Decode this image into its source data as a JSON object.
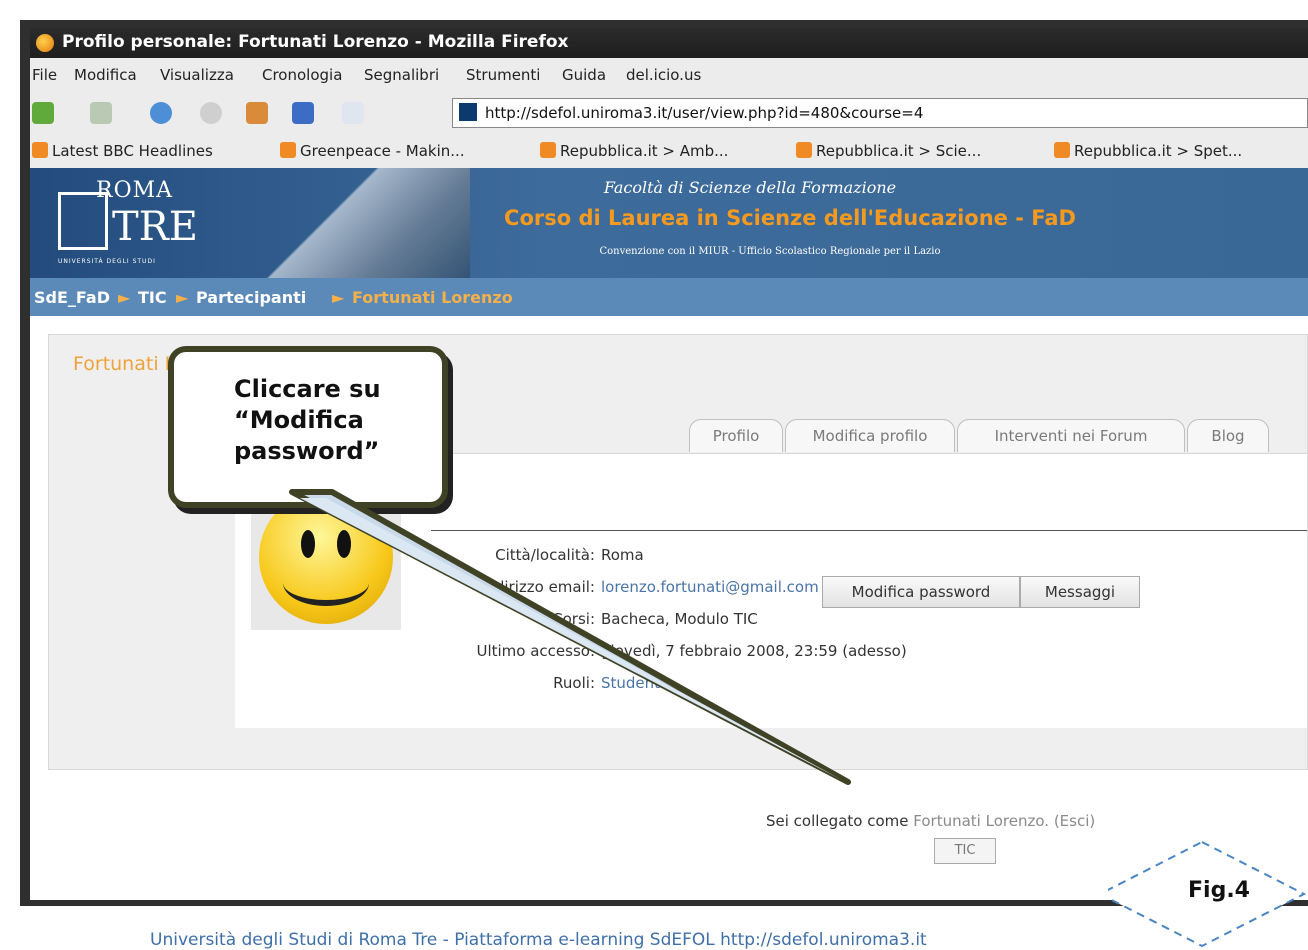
{
  "window": {
    "title": "Profilo personale: Fortunati Lorenzo - Mozilla Firefox"
  },
  "menu": [
    "File",
    "Modifica",
    "Visualizza",
    "Cronologia",
    "Segnalibri",
    "Strumenti",
    "Guida",
    "del.icio.us"
  ],
  "toolbar": {
    "url": "http://sdefol.uniroma3.it/user/view.php?id=480&course=4"
  },
  "bookmarks": [
    "Latest BBC Headlines",
    "Greenpeace - Makin...",
    "Repubblica.it > Amb...",
    "Repubblica.it > Scie...",
    "Repubblica.it > Spet..."
  ],
  "banner": {
    "logo_top": "ROMA",
    "logo_bottom": "TRE",
    "logo_caption": "UNIVERSITÀ DEGLI STUDI",
    "faculty": "Facoltà di Scienze della Formazione",
    "course": "Corso di Laurea in Scienze dell'Educazione - FaD",
    "convention": "Convenzione con il MIUR - Ufficio Scolastico Regionale per il Lazio"
  },
  "breadcrumb": {
    "items": [
      "SdE_FaD",
      "TIC",
      "Partecipanti"
    ],
    "current": "Fortunati Lorenzo",
    "sep": "►"
  },
  "profile": {
    "title": "Fortunati Lorenzo",
    "tabs": [
      "Profilo",
      "Modifica profilo",
      "Interventi nei Forum",
      "Blog"
    ],
    "fields": [
      {
        "label": "Città/località:",
        "value": "Roma"
      },
      {
        "label": "Indirizzo email:",
        "value": "lorenzo.fortunati@gmail.com"
      },
      {
        "label": "Corsi:",
        "value": "Bacheca, Modulo TIC"
      },
      {
        "label": "Ultimo accesso:",
        "value": "giovedì, 7 febbraio 2008, 23:59  (adesso)"
      },
      {
        "label": "Ruoli:",
        "value": "Student"
      }
    ],
    "buttons": {
      "change_password": "Modifica password",
      "messages": "Messaggi"
    }
  },
  "login": {
    "prefix": "Sei collegato come",
    "user": "Fortunati Lorenzo",
    "logout": "(Esci)",
    "course_button": "TIC"
  },
  "callout": {
    "text": "Cliccare su\n“Modifica\npassword”"
  },
  "figure_label": "Fig.4",
  "footer": "Università degli Studi di Roma Tre - Piattaforma e-learning SdEFOL http://sdefol.uniroma3.it",
  "colors": {
    "banner": "#3a6896",
    "accent": "#f59a1e",
    "link": "#4a74a8"
  }
}
